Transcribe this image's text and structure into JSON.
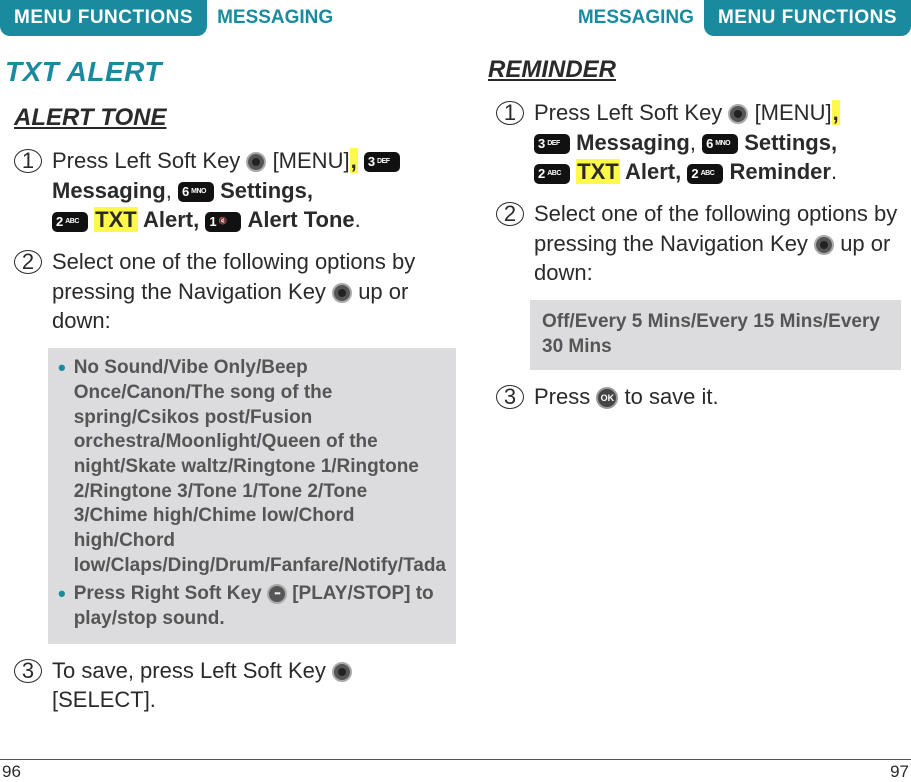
{
  "header": {
    "menu_functions": "MENU FUNCTIONS",
    "messaging": "MESSAGING"
  },
  "left": {
    "title": "TXT ALERT",
    "subtitle": "ALERT TONE",
    "steps": {
      "s1a": "Press Left Soft Key ",
      "s1b": " [MENU]",
      "s1c": " Messaging",
      "s1d": " Settings,",
      "s1e": " Alert,",
      "s1f": " Alert Tone",
      "s2a": "Select one of the following options by pressing the Navigation Key ",
      "s2b": " up or down:",
      "s3a": "To save, press Left Soft Key ",
      "s3b": " [SELECT]."
    },
    "box": {
      "list": "No Sound/Vibe Only/Beep Once/Canon/The song of the spring/Csikos post/Fusion orchestra/Moonlight/Queen of the night/Skate waltz/Ringtone 1/Ringtone 2/Ringtone 3/Tone 1/Tone 2/Tone 3/Chime high/Chime low/Chord high/Chord low/Claps/Ding/Drum/Fanfare/Notify/Tada",
      "play_pre": "Press Right Soft Key ",
      "play_post": " [PLAY/STOP] to play/stop sound."
    },
    "pagenum": "96"
  },
  "right": {
    "title": "REMINDER",
    "steps": {
      "s1a": "Press Left Soft Key ",
      "s1b": " [MENU]",
      "s1c": " Messaging",
      "s1d": " Settings,",
      "s1e": " Alert,",
      "s1f": " Reminder",
      "s2a": "Select one of the following options by pressing the Navigation Key ",
      "s2b": " up or down:",
      "s3a": "Press ",
      "s3b": " to save it."
    },
    "box": "Off/Every 5 Mins/Every 15 Mins/Every 30 Mins",
    "pagenum": "97"
  },
  "keys": {
    "k1": {
      "d": "1",
      "s": ""
    },
    "k2": {
      "d": "2",
      "s": "ABC"
    },
    "k3": {
      "d": "3",
      "s": "DEF"
    },
    "k6": {
      "d": "6",
      "s": "MNO"
    }
  },
  "words": {
    "txt": "TXT",
    "comma": ",",
    "commasep": ", ",
    "ok": "OK",
    "period": "."
  }
}
